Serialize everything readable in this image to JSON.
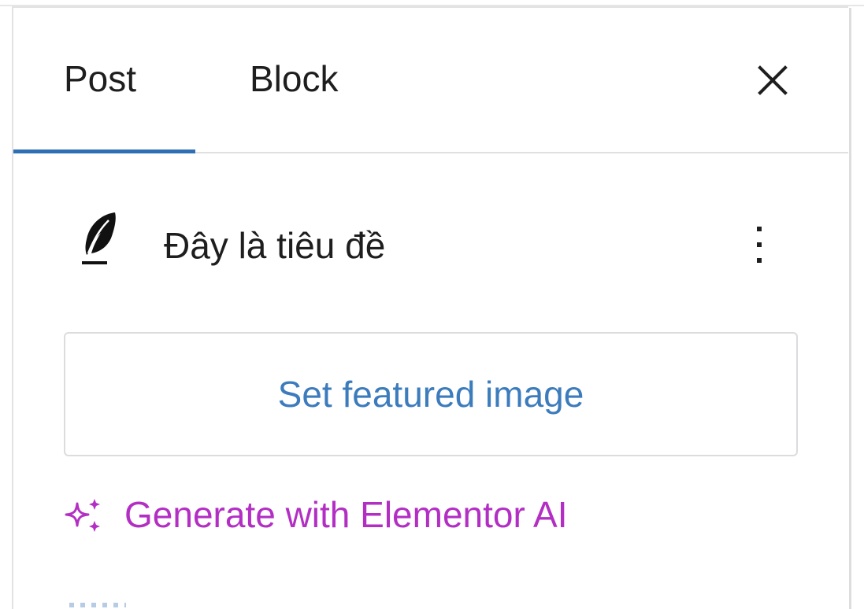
{
  "tabs": [
    {
      "label": "Post",
      "active": true
    },
    {
      "label": "Block",
      "active": false
    }
  ],
  "header": {
    "close_icon": "close-icon"
  },
  "post": {
    "title": "Đây là tiêu đề",
    "icon": "feather-icon",
    "more_icon": "vertical-ellipsis-icon"
  },
  "featured_image": {
    "label": "Set featured image"
  },
  "ai": {
    "label": "Generate with Elementor AI",
    "icon": "sparkles-icon",
    "color": "#b32fc4"
  },
  "colors": {
    "accent": "#2f6fb6",
    "link": "#3c7cbd",
    "text": "#1e1e1e",
    "border": "#dcdcde"
  }
}
